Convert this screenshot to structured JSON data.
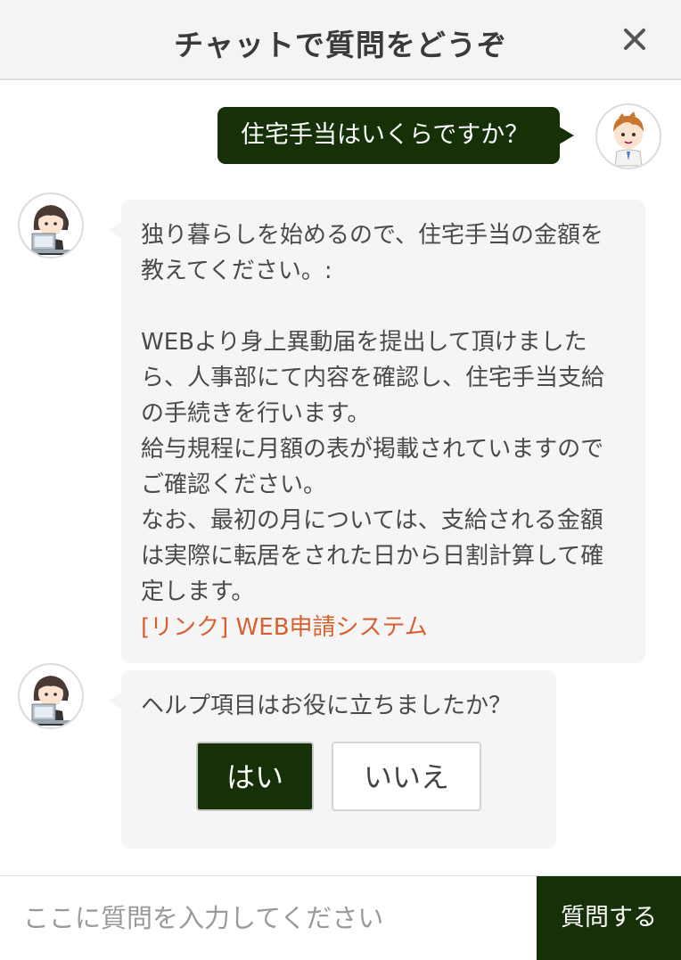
{
  "header": {
    "title": "チャットで質問をどうぞ",
    "close_label": "×"
  },
  "colors": {
    "accent": "#163008",
    "link": "#d7602f",
    "bubble": "#f5f5f5"
  },
  "messages": {
    "user_question": "住宅手当はいくらですか？",
    "answer": {
      "question_echo": "独り暮らしを始めるので、住宅手当の金額を教えてください。:",
      "line1": "WEBより身上異動届を提出して頂けましたら、人事部にて内容を確認し、住宅手当支給の手続きを行います。",
      "line2": "給与規程に月額の表が掲載されていますのでご確認ください。",
      "line3": "なお、最初の月については、支給される金額は実際に転居をされた日から日割計算して確定します。",
      "link_text": "[リンク] WEB申請システム"
    },
    "feedback": {
      "prompt": "ヘルプ項目はお役に立ちましたか？",
      "yes": "はい",
      "no": "いいえ"
    }
  },
  "input": {
    "placeholder": "ここに質問を入力してください",
    "value": "",
    "submit_label": "質問する"
  }
}
